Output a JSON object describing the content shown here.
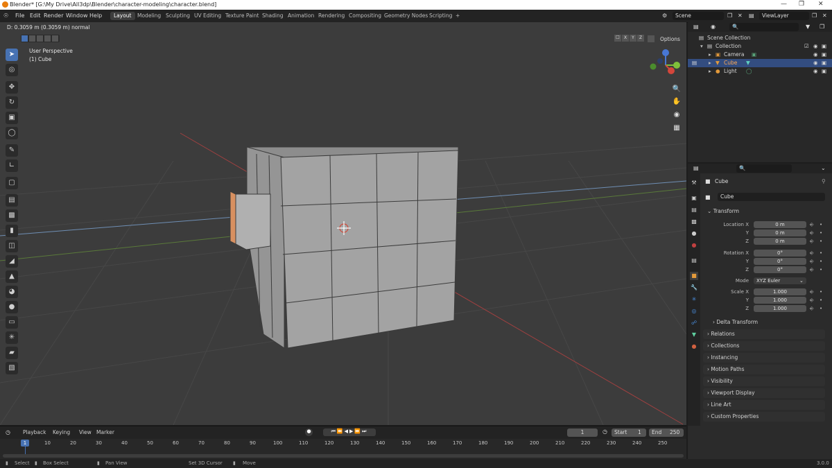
{
  "window": {
    "title": "Blender* [G:\\My Drive\\All3dp\\Blender\\character-modeling\\character.blend]"
  },
  "menu": [
    "File",
    "Edit",
    "Render",
    "Window",
    "Help"
  ],
  "workspaces": [
    "Layout",
    "Modeling",
    "Sculpting",
    "UV Editing",
    "Texture Paint",
    "Shading",
    "Animation",
    "Rendering",
    "Compositing",
    "Geometry Nodes",
    "Scripting",
    "+"
  ],
  "scene": {
    "name": "Scene",
    "view_layer": "ViewLayer"
  },
  "viewport": {
    "status": "D: 0.3059 m (0.3059 m) normal",
    "perspective": "User Perspective",
    "object": "(1) Cube",
    "options": "Options",
    "axes": [
      "X",
      "Y",
      "Z"
    ]
  },
  "outliner": {
    "items": [
      {
        "label": "Scene Collection"
      },
      {
        "label": "Collection"
      },
      {
        "label": "Camera"
      },
      {
        "label": "Cube"
      },
      {
        "label": "Light"
      }
    ]
  },
  "properties": {
    "object_name": "Cube",
    "data_name": "Cube",
    "transform_header": "Transform",
    "location_label": "Location X",
    "rotation_label": "Rotation X",
    "mode_label": "Mode",
    "scale_label": "Scale X",
    "y_label": "Y",
    "z_label": "Z",
    "location": [
      "0 m",
      "0 m",
      "0 m"
    ],
    "rotation": [
      "0°",
      "0°",
      "0°"
    ],
    "mode": "XYZ Euler",
    "scale": [
      "1.000",
      "1.000",
      "1.000"
    ],
    "delta": "Delta Transform",
    "panels": [
      "Relations",
      "Collections",
      "Instancing",
      "Motion Paths",
      "Visibility",
      "Viewport Display",
      "Line Art",
      "Custom Properties"
    ]
  },
  "timeline": {
    "menus": [
      "Playback",
      "Keying",
      "View",
      "Marker"
    ],
    "current_frame": "1",
    "start_label": "Start",
    "start": "1",
    "end_label": "End",
    "end": "250",
    "ticks": [
      "1",
      "10",
      "20",
      "30",
      "40",
      "50",
      "60",
      "70",
      "80",
      "90",
      "100",
      "110",
      "120",
      "130",
      "140",
      "150",
      "160",
      "170",
      "180",
      "190",
      "200",
      "210",
      "220",
      "230",
      "240",
      "250"
    ]
  },
  "statusbar": {
    "items": [
      "Select",
      "Box Select",
      "Pan View",
      "Set 3D Cursor",
      "Move"
    ],
    "version": "3.0.0"
  },
  "colors": {
    "accent": "#4772b3",
    "selected_row": "#334d80",
    "orange": "#e87d0d"
  }
}
